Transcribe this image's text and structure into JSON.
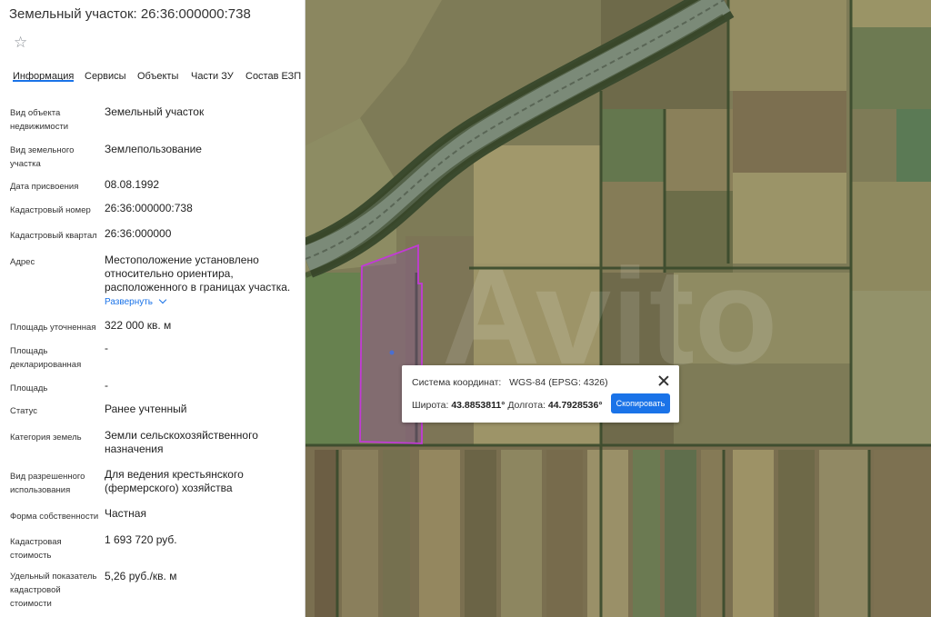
{
  "title": "Земельный участок: 26:36:000000:738",
  "tabs": [
    "Информация",
    "Сервисы",
    "Объекты",
    "Части ЗУ",
    "Состав ЕЗП"
  ],
  "active_tab": "Информация",
  "fields": [
    {
      "label": "Вид объекта недвижимости",
      "value": "Земельный участок"
    },
    {
      "label": "Вид земельного участка",
      "value": "Землепользование"
    },
    {
      "label": "Дата присвоения",
      "value": "08.08.1992"
    },
    {
      "label": "Кадастровый номер",
      "value": "26:36:000000:738"
    },
    {
      "label": "Кадастровый квартал",
      "value": "26:36:000000"
    },
    {
      "label": "Адрес",
      "value": "Местоположение установлено относительно ориентира, расположенного в границах участка."
    },
    {
      "label": "Площадь уточненная",
      "value": "322 000 кв. м"
    },
    {
      "label": "Площадь декларированная",
      "value": "-"
    },
    {
      "label": "Площадь",
      "value": "-"
    },
    {
      "label": "Статус",
      "value": "Ранее учтенный"
    },
    {
      "label": "Категория земель",
      "value": "Земли сельскохозяйственного назначения"
    },
    {
      "label": "Вид разрешенного использования",
      "value": "Для ведения крестьянского (фермерского) хозяйства"
    },
    {
      "label": "Форма собственности",
      "value": "Частная"
    },
    {
      "label": "Кадастровая стоимость",
      "value": "1 693 720 руб."
    },
    {
      "label": "Удельный показатель кадастровой стоимости",
      "value": "5,26 руб./кв. м"
    }
  ],
  "expand_label": "Развернуть",
  "popup": {
    "system_label": "Система координат:",
    "system_value": "WGS-84 (EPSG: 4326)",
    "lat_label": "Широта:",
    "lat_value": "43.8853811°",
    "lon_label": "Долгота:",
    "lon_value": "44.7928536°",
    "copy_label": "Скопировать"
  },
  "icons": {
    "favorite": "star-icon",
    "expand": "chevron-down-icon",
    "close": "close-icon"
  },
  "colors": {
    "accent": "#1a73e8",
    "parcel_outline": "#c23ad6",
    "parcel_fill": "#8a4fa0"
  }
}
